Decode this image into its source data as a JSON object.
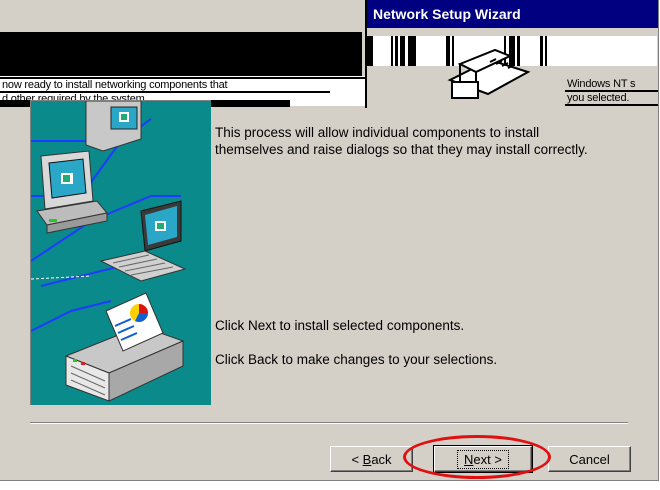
{
  "window": {
    "title": "Network Setup Wizard"
  },
  "corrupted": {
    "line1_left": "now ready to install networking components that",
    "line2_left": "d other required by the system.",
    "line1_right": "Windows NT s",
    "line2_right": "you selected."
  },
  "content": {
    "paragraph1_line1": "This process will allow individual components to install",
    "paragraph1_line2": "themselves and raise dialogs so that they may install correctly.",
    "paragraph2": "Click Next to install selected components.",
    "paragraph3": "Click Back to make changes to your selections."
  },
  "buttons": {
    "back_prefix": "< ",
    "back_hotkey": "B",
    "back_rest": "ack",
    "next_hotkey": "N",
    "next_rest": "ext >",
    "cancel": "Cancel"
  },
  "annotation": {
    "color": "#e01010",
    "target": "next-button"
  },
  "colors": {
    "title_bar": "#000080",
    "art_background": "#0a8a8a",
    "dialog_face": "#d4d0c8"
  }
}
